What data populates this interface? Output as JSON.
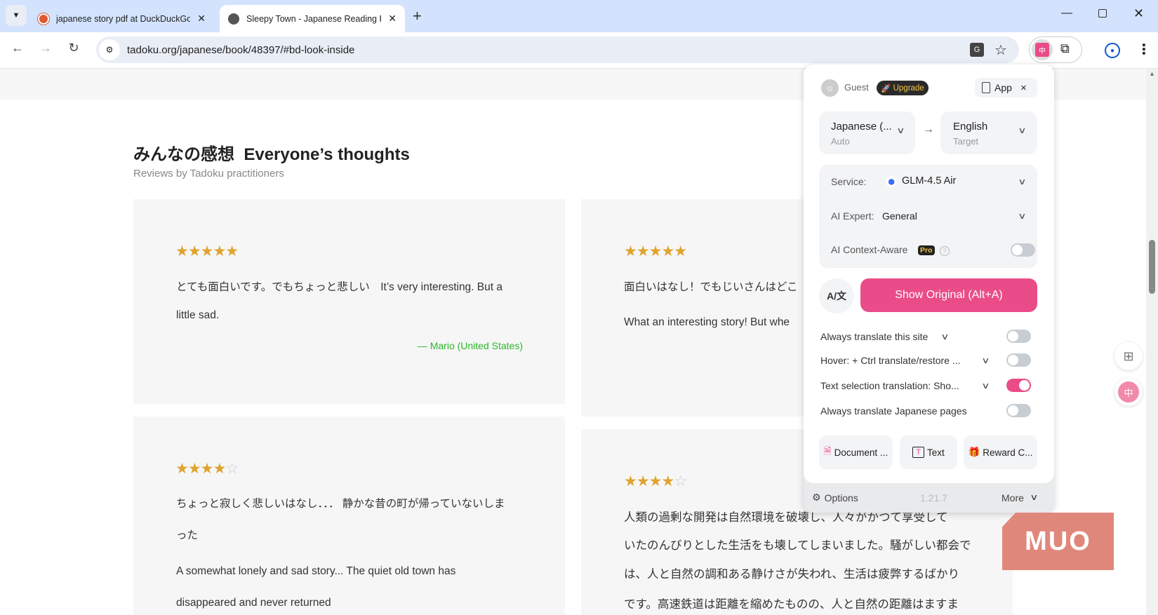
{
  "browser": {
    "tabs": [
      {
        "title": "japanese story pdf at DuckDuckGo",
        "icon": "duckduckgo-icon",
        "active": false
      },
      {
        "title": "Sleepy Town - Japanese Reading Practice",
        "icon": "globe-icon",
        "active": true
      }
    ],
    "url": "tadoku.org/japanese/book/48397/#bd-look-inside"
  },
  "page": {
    "heading_jp": "みんなの感想",
    "heading_en": "Everyone’s thoughts",
    "subtitle": "Reviews by Tadoku practitioners",
    "reviews": [
      {
        "rating": 5,
        "lines": [
          "とても面白いです。でもちょっと悲しい　It’s very interesting. But a",
          "little sad."
        ],
        "author": "— Mario (United States)"
      },
      {
        "rating": 5,
        "lines": [
          "面白いはなし！でもじいさんはどこ",
          "What an interesting story! But whe"
        ]
      },
      {
        "rating": 4,
        "lines": [
          "ちょっと寂しく悲しいはなし．．．  静かな昔の町が帰っていないしま",
          "った",
          "A somewhat lonely and sad story... The quiet old town has",
          "disappeared and never returned"
        ]
      },
      {
        "rating": 4,
        "lines": [
          "人類の過剰な開発は自然環境を破壊し、人々がかつて享受して",
          "いたのんびりとした生活をも壊してしまいました。騒がしい都会で",
          "は、人と自然の調和ある静けさが失われ、生活は疲弊するばかり",
          "です。高速鉄道は距離を縮めたものの、人と自然の距離はますま"
        ]
      }
    ]
  },
  "popup": {
    "user": "Guest",
    "upgrade": "Upgrade",
    "app": "App",
    "source_lang": "Japanese (...",
    "source_sub": "Auto",
    "target_lang": "English",
    "target_sub": "Target",
    "service_label": "Service:",
    "service_value": "GLM-4.5 Air",
    "expert_label": "AI Expert:",
    "expert_value": "General",
    "context_label": "AI Context-Aware",
    "pro_badge": "Pro",
    "context_on": false,
    "show_original": "Show Original (Alt+A)",
    "settings": [
      {
        "label": "Always translate this site",
        "on": false
      },
      {
        "label": "Hover:  + Ctrl translate/restore ...",
        "on": false
      },
      {
        "label": "Text selection translation:  Sho...",
        "on": true
      },
      {
        "label": "Always translate Japanese pages",
        "on": false
      }
    ],
    "buttons": [
      "Document ...",
      "Text",
      "Reward C..."
    ],
    "options": "Options",
    "version": "1.21.7",
    "more": "More",
    "accent": "#e94c88"
  },
  "watermark": "MUO"
}
